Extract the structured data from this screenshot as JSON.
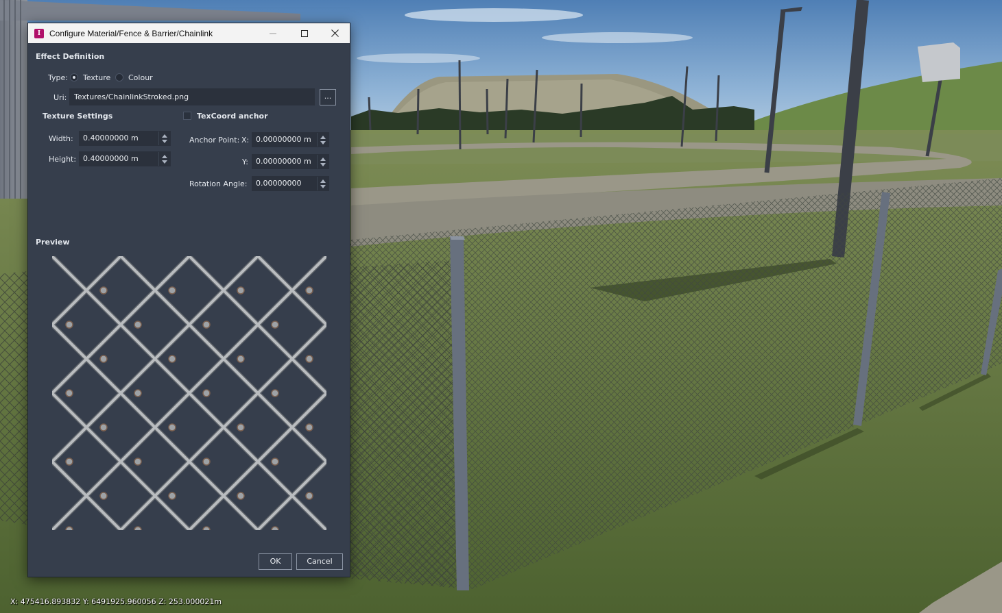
{
  "window": {
    "title": "Configure Material/Fence & Barrier/Chainlink"
  },
  "effect": {
    "heading": "Effect Definition",
    "type_label": "Type:",
    "type_options": [
      "Texture",
      "Colour"
    ],
    "selected_type": "Texture",
    "uri_label": "Uri:",
    "uri_value": "Textures/ChainlinkStroked.png",
    "browse_label": "..."
  },
  "texture": {
    "heading": "Texture Settings",
    "width_label": "Width:",
    "width_value": "0.40000000 m",
    "height_label": "Height:",
    "height_value": "0.40000000 m"
  },
  "texcoord": {
    "heading": "TexCoord anchor",
    "checked": false,
    "anchor_point_label": "Anchor Point:",
    "x_label": "X:",
    "x_value": "0.00000000 m",
    "y_label": "Y:",
    "y_value": "0.00000000 m",
    "rotation_label": "Rotation Angle:",
    "rotation_value": "0.00000000"
  },
  "preview": {
    "heading": "Preview"
  },
  "buttons": {
    "ok": "OK",
    "cancel": "Cancel"
  },
  "status": {
    "coordinates": "X: 475416.893832 Y: 6491925.960056 Z: 253.000021m"
  },
  "colors": {
    "dialog_bg": "#363e4c",
    "field_bg": "#2b313c",
    "sky": "#8fb3d6",
    "grass": "#55692f",
    "app_icon": "#b0106a"
  }
}
